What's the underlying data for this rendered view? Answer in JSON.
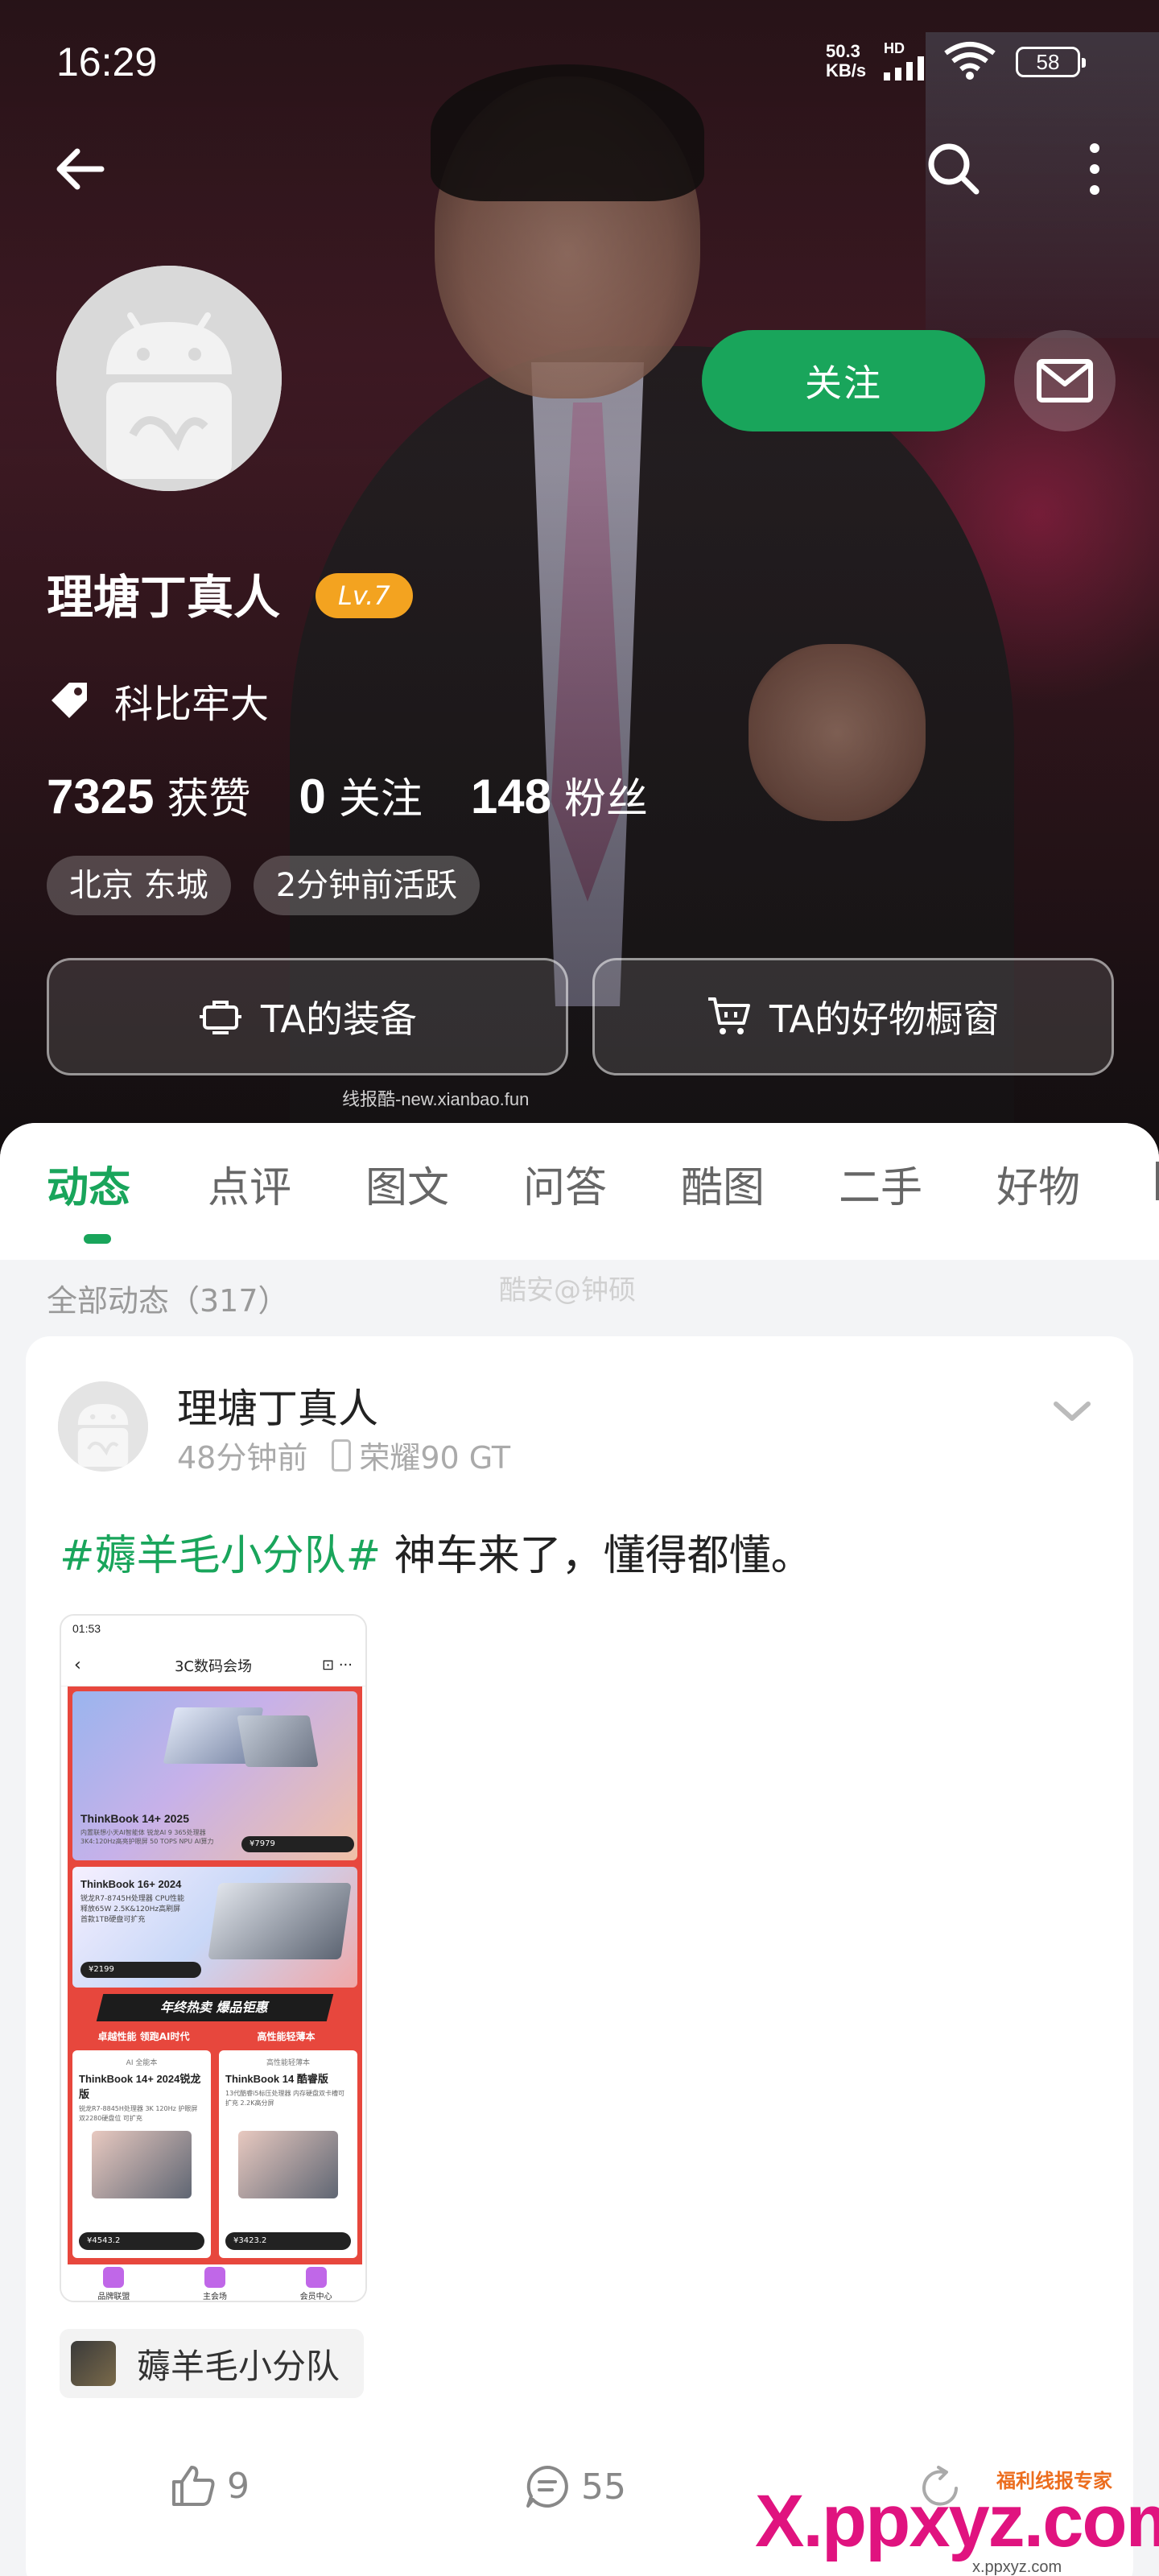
{
  "status": {
    "time": "16:29",
    "speed_top": "50.3",
    "speed_bottom": "KB/s",
    "hd": "HD",
    "battery": "58"
  },
  "profile": {
    "name": "理塘丁真人",
    "level": "Lv.7",
    "tag": "科比牢大",
    "stats": [
      {
        "num": "7325",
        "label": "获赞"
      },
      {
        "num": "0",
        "label": "关注"
      },
      {
        "num": "148",
        "label": "粉丝"
      }
    ],
    "location": "北京 东城",
    "active": "2分钟前活跃",
    "follow_label": "关注",
    "equip_label": "TA的装备",
    "shop_label": "TA的好物橱窗",
    "watermark": "线报酷-new.xianbao.fun"
  },
  "tabs": [
    "动态",
    "点评",
    "图文",
    "问答",
    "酷图",
    "二手",
    "好物"
  ],
  "active_tab": "动态",
  "feed": {
    "section_title": "全部动态（317）",
    "watermark": "酷安@钟硕",
    "post": {
      "author": "理塘丁真人",
      "time": "48分钟前",
      "device": "荣耀90 GT",
      "topic": "#薅羊毛小分队#",
      "text": " 神车来了，懂得都懂。",
      "topic_chip": "薅羊毛小分队",
      "likes": "9",
      "comments": "55"
    }
  },
  "screenshot": {
    "time": "01:53",
    "title": "3C数码会场",
    "b1_title": "ThinkBook 14+ 2025",
    "b1_sub": "内置联想小天AI智能体  锐龙AI 9 365处理器  3K4:120Hz高亮护眼屏  50 TOPS NPU AI算力",
    "b1_price": "¥7979",
    "b2_title": "ThinkBook 16+ 2024",
    "b2_sub": "锐龙R7-8745H处理器 CPU性能释放65W 2.5K&120Hz高刷屏 首款1TB硬盘可扩充",
    "b2_price": "¥2199",
    "promo": "年终热卖 爆品钜惠",
    "promo_left": "卓越性能 领跑AI时代",
    "promo_right": "高性能轻薄本",
    "p1_kicker": "AI 全能本",
    "p1_title": "ThinkBook 14+ 2024锐龙版",
    "p1_sub": "锐龙R7-8845H处理器 3K 120Hz 护眼屏  双2280硬盘位 可扩充",
    "p1_price": "¥4543.2",
    "p2_kicker": "高性能轻薄本",
    "p2_title": "ThinkBook 14 酷睿版",
    "p2_sub": "13代酷睿i5标压处理器 内存硬盘双卡槽可扩充 2.2K高分屏",
    "p2_price": "¥3423.2",
    "nav": [
      "品牌联盟",
      "主会场",
      "会员中心"
    ]
  },
  "watermark_bottom": {
    "brand": "X.ppxyz.com",
    "tag": "福利线报专家",
    "url": "x.ppxyz.com"
  },
  "colors": {
    "accent": "#19a55b",
    "level_badge": "#f3a320"
  }
}
